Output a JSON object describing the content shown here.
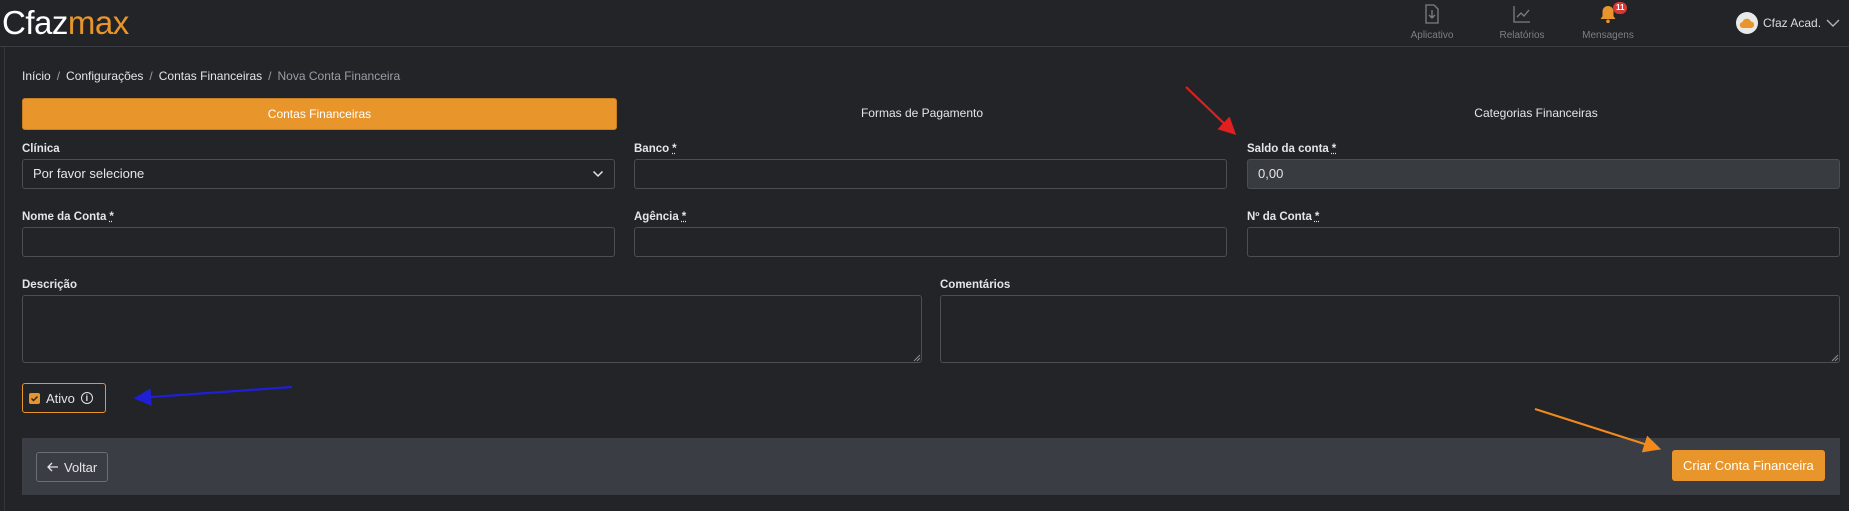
{
  "header": {
    "logo_part1": "Cfaz",
    "logo_part2": "max",
    "nav": [
      {
        "label": "Aplicativo",
        "icon": "download-icon"
      },
      {
        "label": "Relatórios",
        "icon": "chart-icon"
      },
      {
        "label": "Mensagens",
        "icon": "bell-icon",
        "badge": "11"
      }
    ],
    "user_name": "Cfaz Acad."
  },
  "breadcrumb": [
    "Início",
    "Configurações",
    "Contas Financeiras",
    "Nova Conta Financeira"
  ],
  "tabs": [
    "Contas Financeiras",
    "Formas de Pagamento",
    "Categorias Financeiras"
  ],
  "active_tab": "Contas Financeiras",
  "form": {
    "clinica_label": "Clínica",
    "clinica_value": "Por favor selecione",
    "banco_label": "Banco",
    "banco_value": "",
    "saldo_label": "Saldo da conta",
    "saldo_value": "0,00",
    "nome_label": "Nome da Conta",
    "agencia_label": "Agência",
    "numero_label": "Nº da Conta",
    "descricao_label": "Descrição",
    "comentarios_label": "Comentários",
    "required_mark": "*",
    "ativo_label": "Ativo",
    "ativo_checked": true
  },
  "footer": {
    "back_label": "Voltar",
    "create_label": "Criar Conta Financeira"
  },
  "colors": {
    "accent": "#e8962b",
    "background": "#222428",
    "annotation_red": "#e02020",
    "annotation_blue": "#1f1fd6",
    "annotation_orange": "#f08a1c"
  }
}
